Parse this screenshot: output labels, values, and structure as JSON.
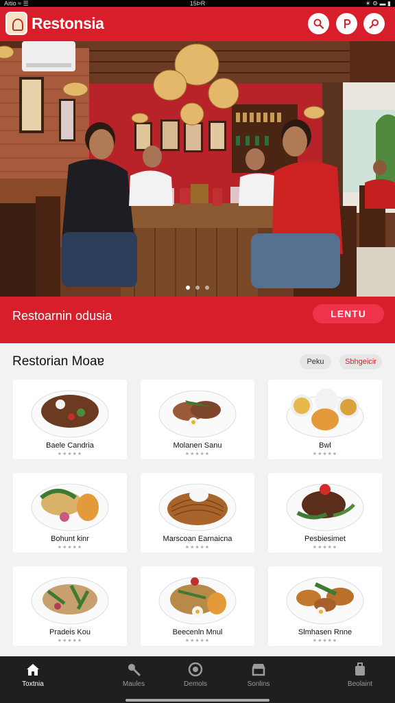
{
  "status_bar": {
    "left": "Aitio ≈ ☰",
    "time": "15ÞR",
    "right": "☀ ⚙ ▬ ▮"
  },
  "header": {
    "title": "Restonsia",
    "accent_color": "#d81e2a",
    "buttons": [
      {
        "icon": "search-icon"
      },
      {
        "icon": "pin-icon"
      },
      {
        "icon": "link-icon"
      }
    ]
  },
  "hero": {
    "carousel_pages": 3,
    "active_page": 1
  },
  "promo": {
    "text": "Restoarnin odusia",
    "button_label": "LENTU",
    "button_color": "#f0334a"
  },
  "menu": {
    "title": "Restorian Moaɐ",
    "filters": [
      "Peku",
      "Sbhgeicir"
    ],
    "items": [
      {
        "name": "Baele Candria",
        "rating": "★★★★★"
      },
      {
        "name": "Molanen Sanu",
        "rating": "★★★★★"
      },
      {
        "name": "Bwl",
        "rating": "★★★★★"
      },
      {
        "name": "Bohunt kinr",
        "rating": "★★★★★"
      },
      {
        "name": "Marscoan Earnaicna",
        "rating": "★★★★★"
      },
      {
        "name": "Pesbiesimet",
        "rating": "★★★★★"
      },
      {
        "name": "Pradeis Kou",
        "rating": "★★★★★"
      },
      {
        "name": "Beecenln Mnul",
        "rating": "★★★★★"
      },
      {
        "name": "Slmhasen Rnne",
        "rating": "★★★★★"
      }
    ]
  },
  "bottom_nav": [
    {
      "label": "Toxtnia",
      "icon": "home-icon",
      "active": true
    },
    {
      "label": "Maules",
      "icon": "tools-icon",
      "active": false
    },
    {
      "label": "Demols",
      "icon": "plate-icon",
      "active": false
    },
    {
      "label": "Sonlins",
      "icon": "store-icon",
      "active": false
    },
    {
      "label": "Beolaint",
      "icon": "bag-icon",
      "active": false
    }
  ]
}
